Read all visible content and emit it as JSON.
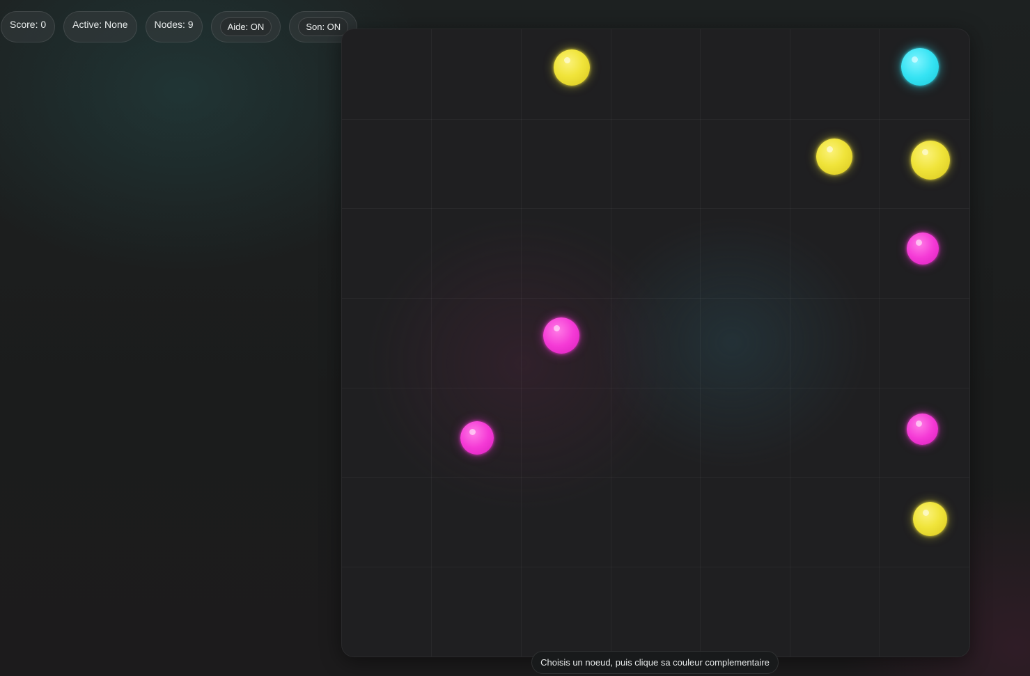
{
  "hud": {
    "score_label": "Score: 0",
    "active_label": "Active: None",
    "nodes_label": "Nodes: 9",
    "aide_button": "Aide: ON",
    "son_button": "Son: ON"
  },
  "colors": {
    "yellow": "#f0e43a",
    "magenta": "#f53ad6",
    "cyan": "#35e3f3",
    "background": "#1b1c1c"
  },
  "board": {
    "grid_columns": 7,
    "grid_rows": 7,
    "nodes": [
      {
        "color": "yellow"
      },
      {
        "color": "cyan"
      },
      {
        "color": "yellow"
      },
      {
        "color": "yellow"
      },
      {
        "color": "magenta"
      },
      {
        "color": "magenta"
      },
      {
        "color": "magenta"
      },
      {
        "color": "magenta"
      },
      {
        "color": "yellow"
      }
    ]
  },
  "hint": {
    "text": "Choisis un noeud, puis clique sa couleur complementaire"
  }
}
